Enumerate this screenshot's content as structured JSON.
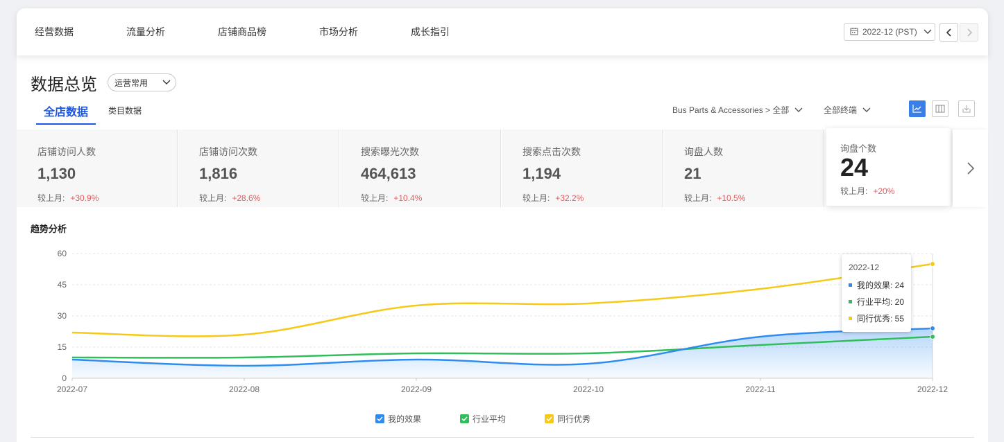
{
  "nav": {
    "items": [
      {
        "label": "经营数据"
      },
      {
        "label": "流量分析"
      },
      {
        "label": "店铺商品榜"
      },
      {
        "label": "市场分析"
      },
      {
        "label": "成长指引"
      }
    ],
    "date_label": "2022-12 (PST)"
  },
  "page": {
    "title": "数据总览",
    "view_select": "运营常用",
    "tabs": [
      {
        "label": "全店数据"
      },
      {
        "label": "类目数据"
      }
    ],
    "category_filter": "Bus Parts & Accessories > 全部",
    "terminal_filter": "全部终端"
  },
  "metrics": [
    {
      "label": "店铺访问人数",
      "value": "1,130",
      "compare_label": "较上月:",
      "change": "+30.9%"
    },
    {
      "label": "店铺访问次数",
      "value": "1,816",
      "compare_label": "较上月:",
      "change": "+28.6%"
    },
    {
      "label": "搜索曝光次数",
      "value": "464,613",
      "compare_label": "较上月:",
      "change": "+10.4%"
    },
    {
      "label": "搜索点击次数",
      "value": "1,194",
      "compare_label": "较上月:",
      "change": "+32.2%"
    },
    {
      "label": "询盘人数",
      "value": "21",
      "compare_label": "较上月:",
      "change": "+10.5%"
    }
  ],
  "selected_metric": {
    "label": "询盘个数",
    "value": "24",
    "compare_label": "较上月:",
    "change": "+20%"
  },
  "trend": {
    "title": "趋势分析"
  },
  "colors": {
    "accent": "#1a56e8",
    "mine": "#2e8cf0",
    "avg": "#2fbe5a",
    "top": "#f5c918",
    "positive_change": "#e35d5d"
  },
  "chart_data": {
    "type": "line",
    "x": [
      "2022-07",
      "2022-08",
      "2022-09",
      "2022-10",
      "2022-11",
      "2022-12"
    ],
    "ylim": [
      0,
      60
    ],
    "yticks": [
      0,
      15,
      30,
      45,
      60
    ],
    "series": [
      {
        "name": "我的效果",
        "values": [
          9,
          6,
          9,
          7,
          20,
          24
        ],
        "color": "#2e8cf0"
      },
      {
        "name": "行业平均",
        "values": [
          10,
          10,
          12,
          12,
          16,
          20
        ],
        "color": "#2fbe5a"
      },
      {
        "name": "同行优秀",
        "values": [
          22,
          21,
          35,
          36,
          43,
          55
        ],
        "color": "#f5c918"
      }
    ],
    "tooltip": {
      "title": "2022-12",
      "rows": [
        {
          "label": "我的效果: 24",
          "color": "#2e8cf0"
        },
        {
          "label": "行业平均: 20",
          "color": "#2fbe5a"
        },
        {
          "label": "同行优秀: 55",
          "color": "#f5c918"
        }
      ]
    },
    "grid": true,
    "legend": "bottom-center"
  }
}
